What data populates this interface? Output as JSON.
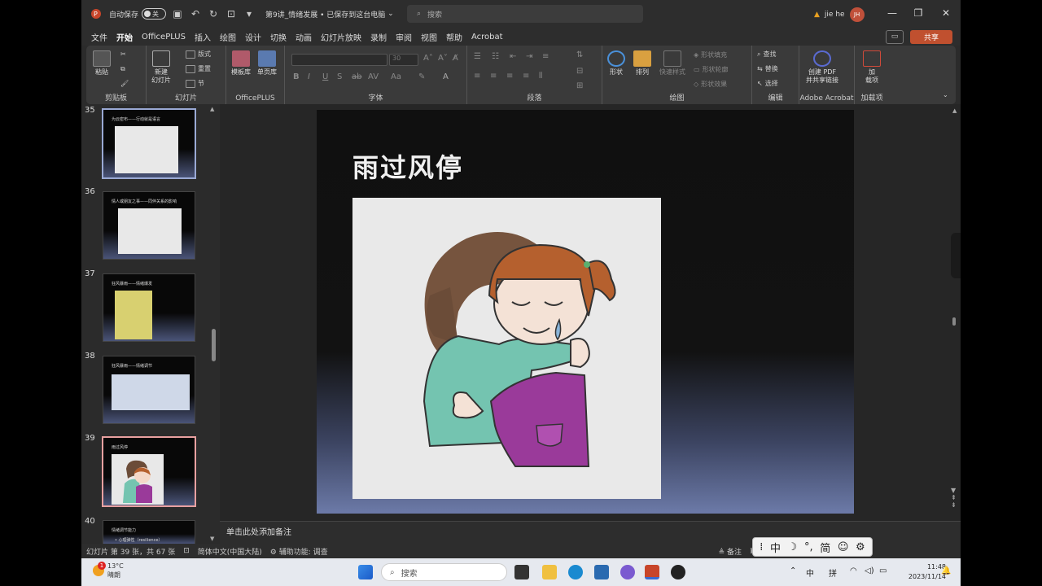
{
  "titlebar": {
    "autosave_label": "自动保存",
    "autosave_state": "关",
    "doc_title": "第9讲_情绪发展 • 已保存到这台电脑",
    "search_placeholder": "搜索",
    "user_name": "jie he",
    "user_initials": "JH"
  },
  "menu": {
    "items": [
      "文件",
      "开始",
      "OfficePLUS",
      "插入",
      "绘图",
      "设计",
      "切换",
      "动画",
      "幻灯片放映",
      "录制",
      "审阅",
      "视图",
      "帮助",
      "Acrobat"
    ],
    "active": "开始",
    "share_label": "共享"
  },
  "ribbon": {
    "clipboard": {
      "label": "剪贴板",
      "paste": "粘贴"
    },
    "slides": {
      "label": "幻灯片",
      "new_slide": "新建",
      "new_slide2": "幻灯片",
      "layout": "版式",
      "reset": "重置",
      "section": "节"
    },
    "officeplus": {
      "label": "OfficePLUS",
      "template": "模板库",
      "single_page": "单页库"
    },
    "font": {
      "label": "字体",
      "size": "30"
    },
    "paragraph": {
      "label": "段落"
    },
    "drawing": {
      "label": "绘图",
      "shape": "形状",
      "arrange": "排列",
      "quick_style": "快速样式",
      "fill": "形状填充",
      "outline": "形状轮廓",
      "effect": "形状效果"
    },
    "editing": {
      "label": "编辑",
      "find": "查找",
      "replace": "替换",
      "select": "选择"
    },
    "acrobat": {
      "label": "Adobe Acrobat",
      "create_pdf": "创建 PDF",
      "share_link": "并共享链接"
    },
    "addins": {
      "label": "加载项",
      "btn": "加",
      "btn2": "载项"
    }
  },
  "thumbnails": [
    {
      "num": "35",
      "title": "为云密布——行动就是语言"
    },
    {
      "num": "36",
      "title": "情人或朋友之事——同伴关系的影响"
    },
    {
      "num": "37",
      "title": "狂风暴雨——情绪爆发"
    },
    {
      "num": "38",
      "title": "狂风暴雨——情绪调节"
    },
    {
      "num": "39",
      "title": "雨过风停"
    },
    {
      "num": "40",
      "title": "情绪调节能力"
    }
  ],
  "thumb40_bullet": "• 心理弹性（resilience）",
  "slide": {
    "title": "雨过风停"
  },
  "notes_placeholder": "单击此处添加备注",
  "status": {
    "slide_info": "幻灯片 第 39 张，共 67 张",
    "language": "简体中文(中国大陆)",
    "accessibility": "辅助功能: 调查",
    "notes": "备注"
  },
  "taskbar": {
    "temperature": "13°C",
    "weather": "晴朗",
    "search": "搜索",
    "time": "11:48",
    "date": "2023/11/14",
    "ime_mode": "中",
    "ime_pinyin": "拼",
    "notification_badge": "1"
  },
  "ime_toolbar": [
    "中",
    "☽",
    "°,",
    "简",
    "☺",
    "⚙"
  ]
}
